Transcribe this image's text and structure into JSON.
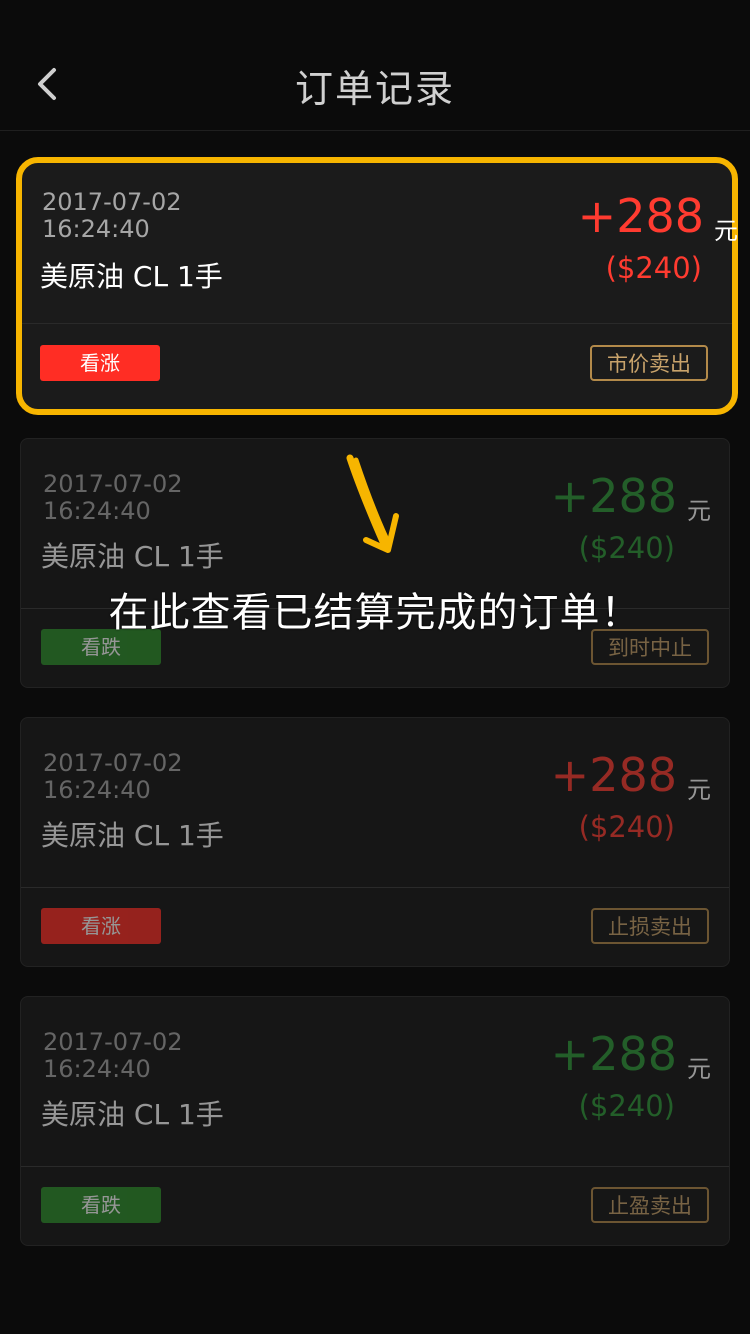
{
  "header": {
    "title": "订单记录",
    "back_icon": "chevron-left-icon"
  },
  "annotation": {
    "text": "在此查看已结算完成的订单！",
    "arrow_icon": "arrow-down-icon",
    "accent_color": "#f7b500"
  },
  "orders": [
    {
      "date": "2017-07-02",
      "time": "16:24:40",
      "product": "美原油 CL 1手",
      "amount": "+288",
      "currency": "元",
      "usd": "($240)",
      "direction": "看涨",
      "action": "市价卖出",
      "color": "#ff3b30"
    },
    {
      "date": "2017-07-02",
      "time": "16:24:40",
      "product": "美原油 CL 1手",
      "amount": "+288",
      "currency": "元",
      "usd": "($240)",
      "direction": "看跌",
      "action": "到时中止",
      "color": "#2e9a3a"
    },
    {
      "date": "2017-07-02",
      "time": "16:24:40",
      "product": "美原油 CL 1手",
      "amount": "+288",
      "currency": "元",
      "usd": "($240)",
      "direction": "看涨",
      "action": "止损卖出",
      "color": "#ff3b30"
    },
    {
      "date": "2017-07-02",
      "time": "16:24:40",
      "product": "美原油 CL 1手",
      "amount": "+288",
      "currency": "元",
      "usd": "($240)",
      "direction": "看跌",
      "action": "止盈卖出",
      "color": "#2e9a3a"
    }
  ]
}
